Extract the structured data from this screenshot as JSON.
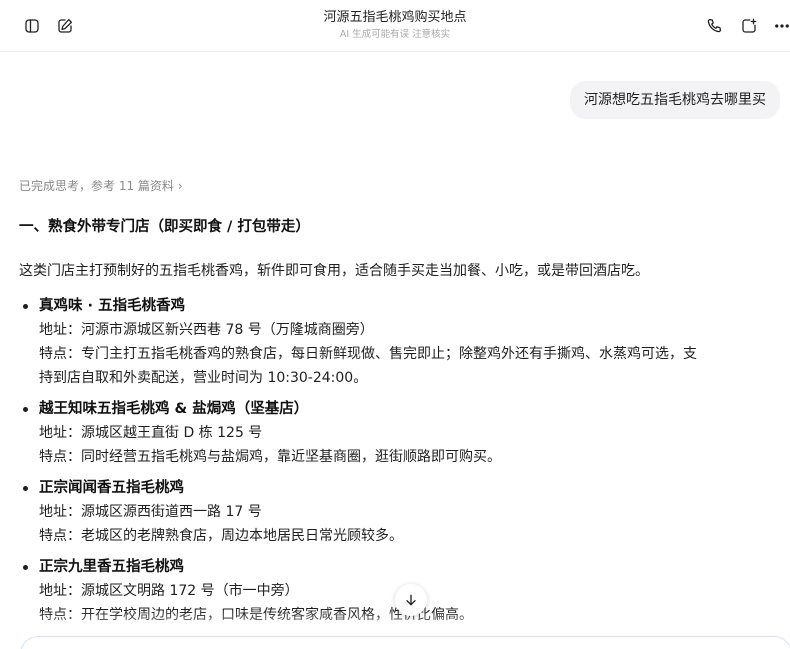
{
  "header": {
    "title": "河源五指毛桃鸡购买地点",
    "subtitle": "AI 生成可能有误 注意核实"
  },
  "icons": {
    "sidebar": "sidebar-toggle-icon",
    "new_chat": "edit-icon",
    "phone": "phone-icon",
    "new_window": "new-chat-icon",
    "more": "more-icon",
    "scroll_down": "arrow-down-icon"
  },
  "conversation": {
    "user_message": "河源想吃五指毛桃鸡去哪里买",
    "thinking_status": "已完成思考，参考 11 篇资料",
    "section_heading": "一、熟食外带专门店（即买即食 / 打包带走）",
    "intro": "这类门店主打预制好的五指毛桃香鸡，斩件即可食用，适合随手买走当加餐、小吃，或是带回酒店吃。",
    "shops": [
      {
        "name": "真鸡味 · 五指毛桃香鸡",
        "address": "地址：河源市源城区新兴西巷 78 号（万隆城商圈旁）",
        "features": [
          "特点：专门主打五指毛桃香鸡的熟食店，每日新鲜现做、售完即止；除整鸡外还有手撕鸡、水蒸鸡可选，支",
          "持到店自取和外卖配送，营业时间为 10:30-24:00。"
        ]
      },
      {
        "name": "越王知味五指毛桃鸡 & 盐焗鸡（坚基店）",
        "address": "地址：源城区越王直街 D 栋 125 号",
        "features": [
          "特点：同时经营五指毛桃鸡与盐焗鸡，靠近坚基商圈，逛街顺路即可购买。"
        ]
      },
      {
        "name": "正宗闻闻香五指毛桃鸡",
        "address": "地址：源城区源西街道西一路 17 号",
        "features": [
          "特点：老城区的老牌熟食店，周边本地居民日常光顾较多。"
        ]
      },
      {
        "name": "正宗九里香五指毛桃鸡",
        "address": "地址：源城区文明路 172 号（市一中旁）",
        "features": [
          "特点：开在学校周边的老店，口味是传统客家咸香风格，性价比偏高。"
        ]
      }
    ]
  }
}
